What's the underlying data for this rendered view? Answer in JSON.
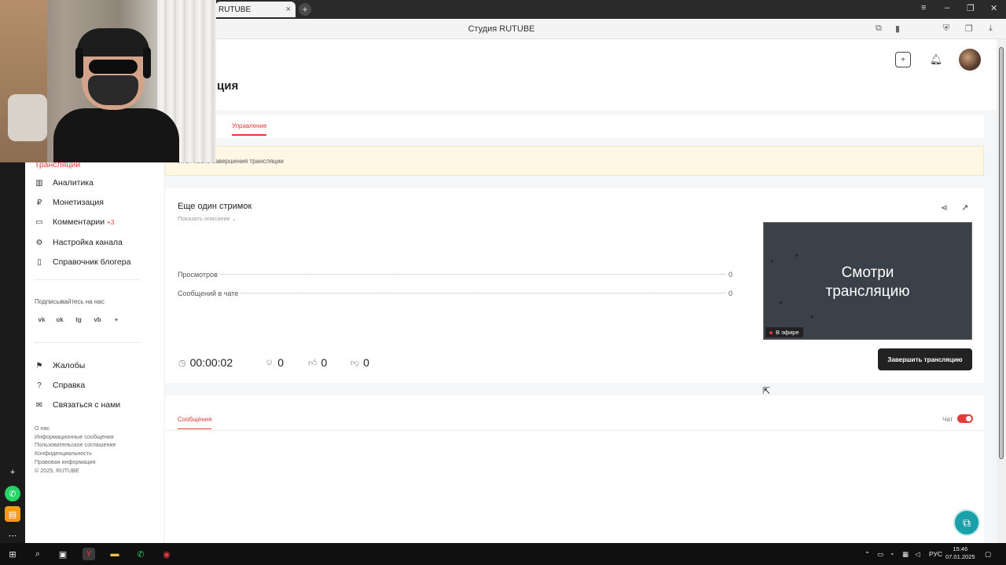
{
  "browser": {
    "tab_title": "RUTUBE",
    "tab_close": "×",
    "new_tab": "+",
    "page_title": "Студия RUTUBE",
    "window_controls": [
      "≡",
      "–",
      "❐",
      "✕"
    ]
  },
  "header": {
    "page_heading": "ция"
  },
  "sidebar": {
    "active_item": "Трансляции",
    "items": [
      {
        "label": "Аналитика",
        "icon": "analytics-icon"
      },
      {
        "label": "Монетизация",
        "icon": "monetization-icon"
      },
      {
        "label": "Комментарии",
        "badge": "+3",
        "icon": "comments-icon"
      },
      {
        "label": "Настройка канала",
        "icon": "settings-icon"
      },
      {
        "label": "Справочник блогера",
        "icon": "handbook-icon"
      }
    ],
    "subscribe_label": "Подписывайтесь на нас",
    "social": [
      "vk",
      "ok",
      "tg",
      "vb",
      "+"
    ],
    "secondary_items": [
      {
        "label": "Жалобы",
        "icon": "flag-icon"
      },
      {
        "label": "Справка",
        "icon": "help-icon"
      },
      {
        "label": "Связаться с нами",
        "icon": "mail-icon"
      }
    ],
    "footer_links": [
      "О нас",
      "Информационные сообщения",
      "Пользовательское соглашение",
      "Конфиденциальность",
      "Правовая информация",
      "© 2025, RUTUBE"
    ]
  },
  "tabs": {
    "manage": "Управление"
  },
  "notice": {
    "text": "...тся после завершения трансляции"
  },
  "stream": {
    "title": "Еще один стримок",
    "show_description": "Показать описание ⌄",
    "stats": [
      {
        "label": "Просмотров",
        "value": "0"
      },
      {
        "label": "Сообщений в чате",
        "value": "0"
      }
    ],
    "thumbnail_text_line1": "Смотри",
    "thumbnail_text_line2": "трансляцию",
    "live_badge": "В эфире",
    "duration": "00:00:02",
    "viewers": "0",
    "likes": "0",
    "dislikes": "0",
    "end_button": "Завершить трансляцию"
  },
  "messages": {
    "tab": "Сообщения",
    "chat_label": "Чат",
    "chat_enabled": true
  },
  "taskbar": {
    "lang": "РУС",
    "time": "15:46",
    "date": "07.01.2025"
  },
  "colors": {
    "accent": "#e33b3b",
    "dark_button": "#222222",
    "support": "#1aa0a8"
  }
}
